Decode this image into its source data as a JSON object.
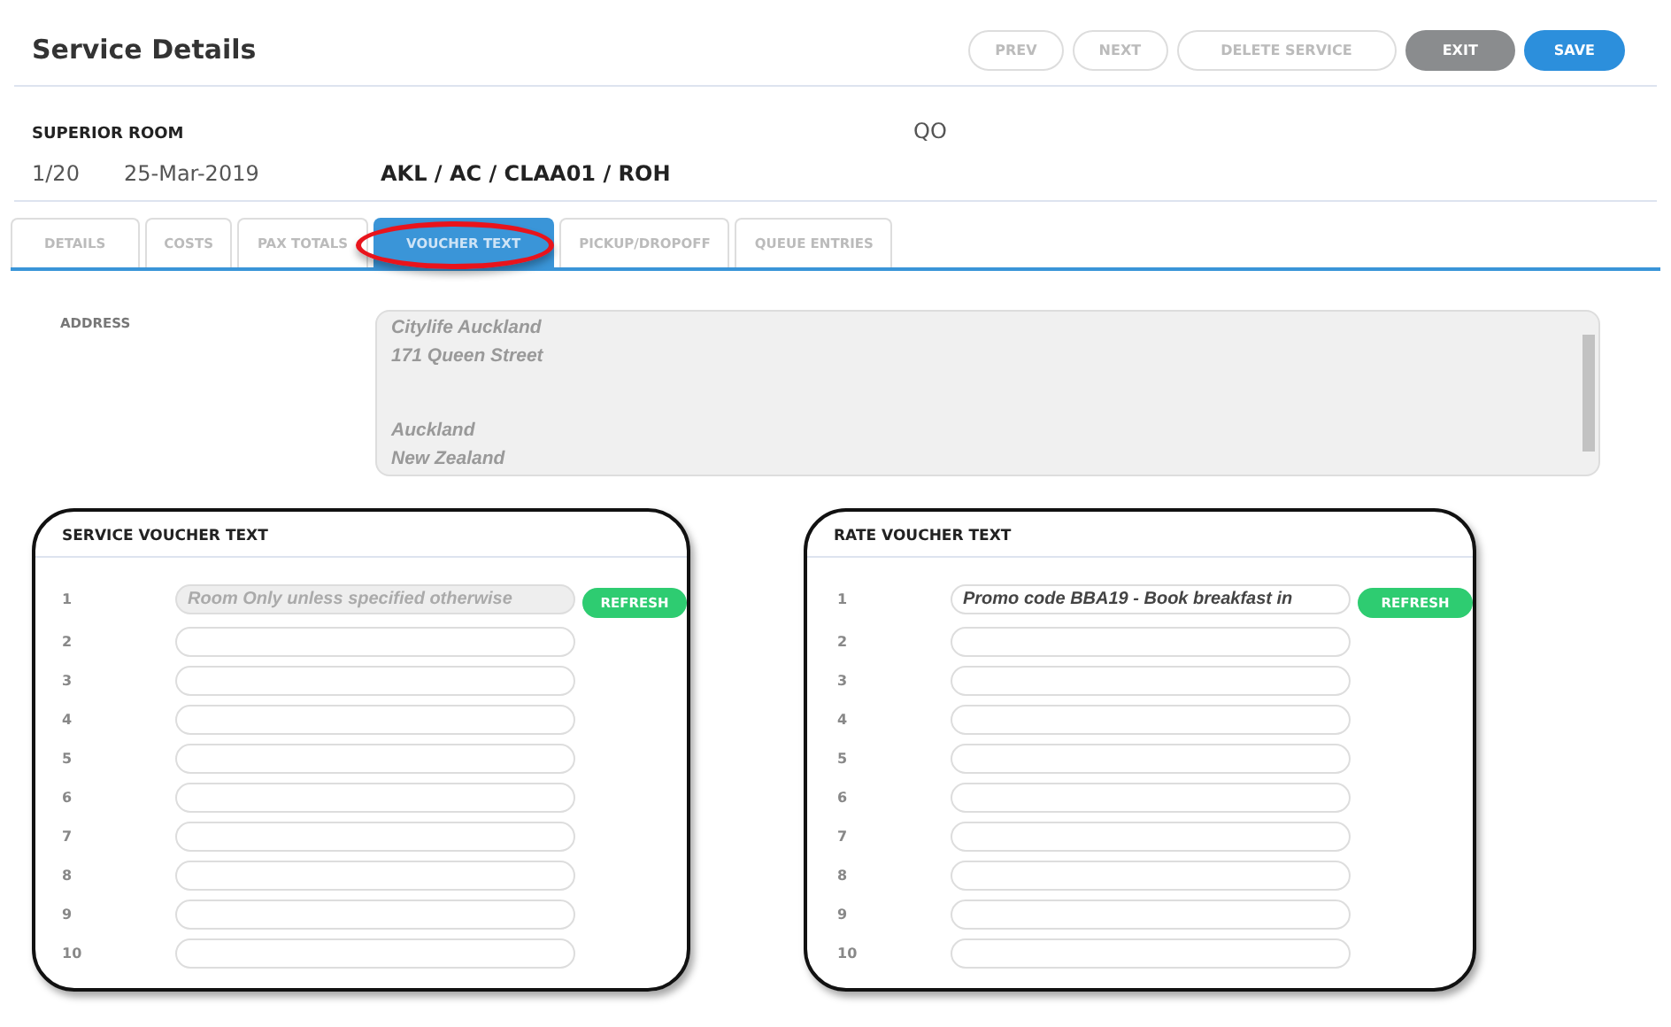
{
  "header": {
    "title": "Service Details",
    "buttons": [
      {
        "label": "PREV",
        "kind": "outline"
      },
      {
        "label": "NEXT",
        "kind": "outline"
      },
      {
        "label": "DELETE SERVICE",
        "kind": "outline"
      },
      {
        "label": "EXIT",
        "kind": "grey"
      },
      {
        "label": "SAVE",
        "kind": "primary"
      }
    ]
  },
  "service": {
    "name": "SUPERIOR ROOM",
    "code": "QO",
    "sequence": "1/20",
    "date": "25-Mar-2019",
    "route": "AKL / AC / CLAA01 / ROH"
  },
  "tabs": [
    {
      "label": "DETAILS",
      "selected": false
    },
    {
      "label": "COSTS",
      "selected": false
    },
    {
      "label": "PAX TOTALS",
      "selected": false
    },
    {
      "label": "VOUCHER TEXT",
      "selected": true,
      "highlighted": true
    },
    {
      "label": "PICKUP/DROPOFF",
      "selected": false
    },
    {
      "label": "QUEUE ENTRIES",
      "selected": false
    }
  ],
  "address": {
    "label": "ADDRESS",
    "lines": [
      {
        "text": "Citylife Auckland",
        "gap_before": false
      },
      {
        "text": "171 Queen Street",
        "gap_before": false
      },
      {
        "text": "Auckland",
        "gap_before": true
      },
      {
        "text": "New Zealand",
        "gap_before": false
      }
    ]
  },
  "panels": [
    {
      "title": "SERVICE VOUCHER TEXT",
      "button": "REFRESH",
      "lines": [
        {
          "number": "1",
          "value": "Room Only unless specified otherwise",
          "disabled": true
        },
        {
          "number": "2",
          "disabled": false
        },
        {
          "number": "3",
          "disabled": false
        },
        {
          "number": "4",
          "disabled": false
        },
        {
          "number": "5",
          "disabled": false
        },
        {
          "number": "6",
          "disabled": false
        },
        {
          "number": "7",
          "disabled": false
        },
        {
          "number": "8",
          "disabled": false
        },
        {
          "number": "9",
          "disabled": false
        },
        {
          "number": "10",
          "disabled": false
        }
      ]
    },
    {
      "title": "RATE VOUCHER TEXT",
      "button": "REFRESH",
      "lines": [
        {
          "number": "1",
          "value": "Promo code BBA19 - Book breakfast in",
          "disabled": false
        },
        {
          "number": "2",
          "disabled": false
        },
        {
          "number": "3",
          "disabled": false
        },
        {
          "number": "4",
          "disabled": false
        },
        {
          "number": "5",
          "disabled": false
        },
        {
          "number": "6",
          "disabled": false
        },
        {
          "number": "7",
          "disabled": false
        },
        {
          "number": "8",
          "disabled": false
        },
        {
          "number": "9",
          "disabled": false
        },
        {
          "number": "10",
          "disabled": false
        }
      ]
    }
  ]
}
